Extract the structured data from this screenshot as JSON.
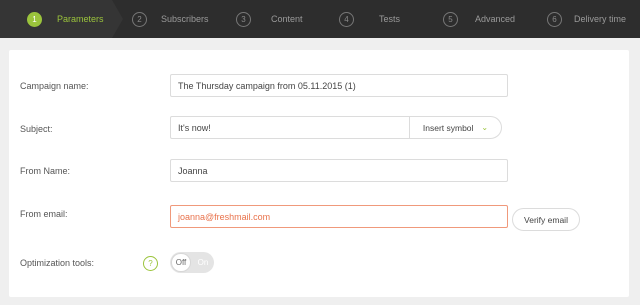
{
  "wizard": {
    "steps": [
      {
        "number": "1",
        "label": "Parameters",
        "active": true
      },
      {
        "number": "2",
        "label": "Subscribers",
        "active": false
      },
      {
        "number": "3",
        "label": "Content",
        "active": false
      },
      {
        "number": "4",
        "label": "Tests",
        "active": false
      },
      {
        "number": "5",
        "label": "Advanced",
        "active": false
      },
      {
        "number": "6",
        "label": "Delivery time",
        "active": false
      }
    ],
    "active_color": "#9bc43c"
  },
  "form": {
    "campaign_name": {
      "label": "Campaign name:",
      "value": "The Thursday campaign from 05.11.2015 (1)"
    },
    "subject": {
      "label": "Subject:",
      "value": "It's now!",
      "insert_symbol_label": "Insert symbol"
    },
    "from_name": {
      "label": "From Name:",
      "value": "Joanna"
    },
    "from_email": {
      "label": "From email:",
      "value": "joanna@freshmail.com",
      "verify_label": "Verify email",
      "error_color": "#e9724b"
    },
    "optimization": {
      "label": "Optimization tools:",
      "help": "?",
      "toggle_off": "Off",
      "toggle_on": "On",
      "state": "off"
    }
  },
  "icons": {
    "dropdown": "chevron-down-icon",
    "help": "question-icon"
  }
}
